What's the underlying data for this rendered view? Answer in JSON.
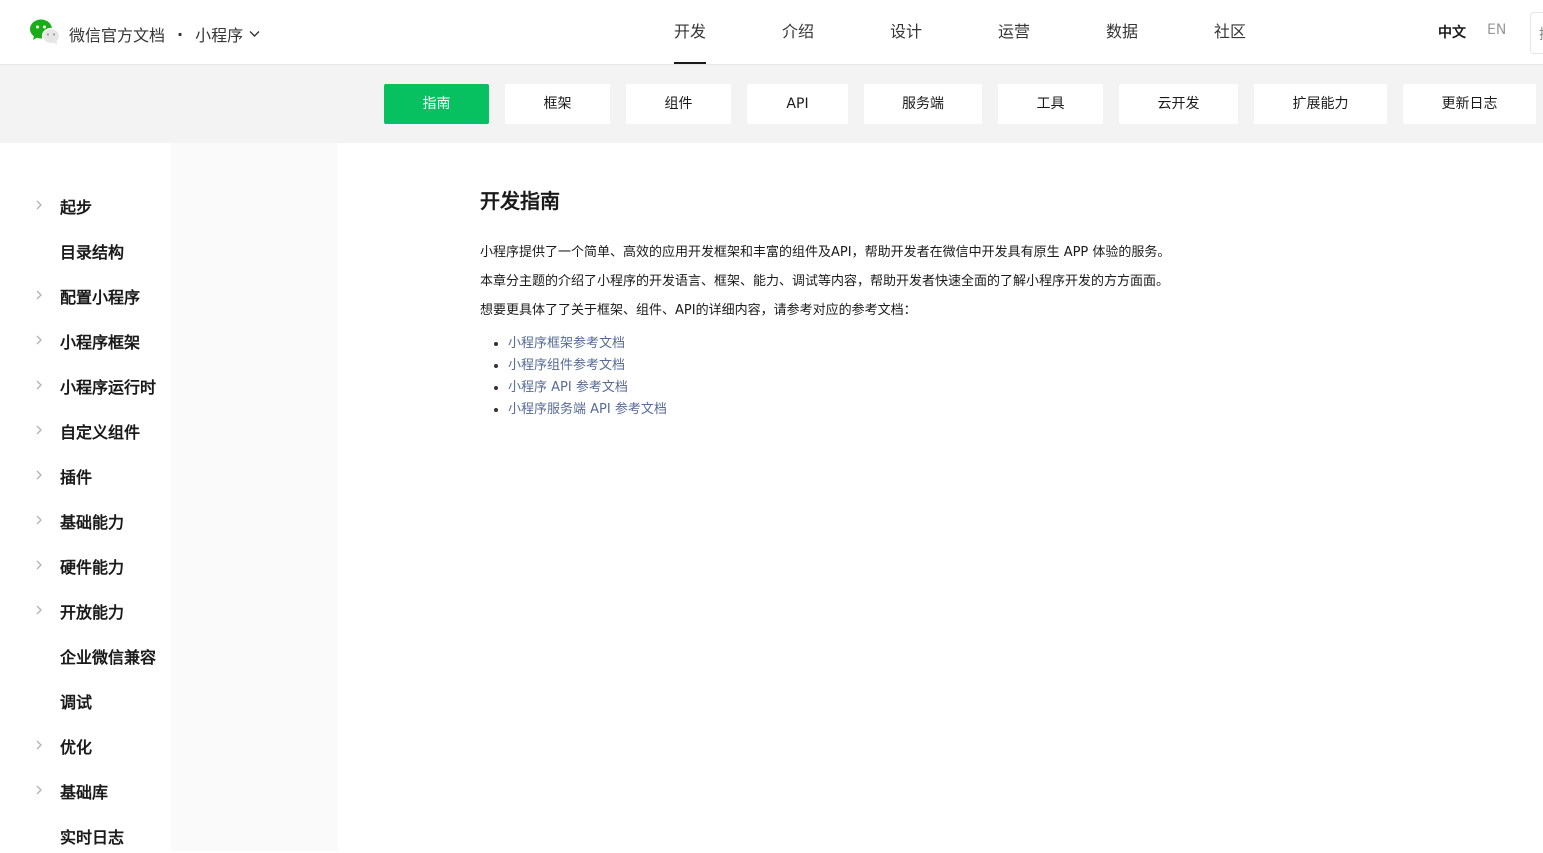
{
  "header": {
    "brand": "微信官方文档",
    "separator": "·",
    "product": "小程序",
    "nav": [
      "开发",
      "介绍",
      "设计",
      "运营",
      "数据",
      "社区"
    ],
    "active_nav": "开发",
    "lang_zh": "中文",
    "lang_en": "EN",
    "search_glyph": "搜"
  },
  "subnav": {
    "tabs": [
      "指南",
      "框架",
      "组件",
      "API",
      "服务端",
      "工具",
      "云开发",
      "扩展能力",
      "更新日志"
    ],
    "active": "指南"
  },
  "sidebar": {
    "items": [
      {
        "label": "起步",
        "expandable": true
      },
      {
        "label": "目录结构",
        "expandable": false
      },
      {
        "label": "配置小程序",
        "expandable": true
      },
      {
        "label": "小程序框架",
        "expandable": true
      },
      {
        "label": "小程序运行时",
        "expandable": true
      },
      {
        "label": "自定义组件",
        "expandable": true
      },
      {
        "label": "插件",
        "expandable": true
      },
      {
        "label": "基础能力",
        "expandable": true
      },
      {
        "label": "硬件能力",
        "expandable": true
      },
      {
        "label": "开放能力",
        "expandable": true
      },
      {
        "label": "企业微信兼容",
        "expandable": false
      },
      {
        "label": "调试",
        "expandable": false
      },
      {
        "label": "优化",
        "expandable": true
      },
      {
        "label": "基础库",
        "expandable": true
      },
      {
        "label": "实时日志",
        "expandable": false
      }
    ]
  },
  "content": {
    "title": "开发指南",
    "paragraphs": [
      "小程序提供了一个简单、高效的应用开发框架和丰富的组件及API，帮助开发者在微信中开发具有原生 APP 体验的服务。",
      "本章分主题的介绍了小程序的开发语言、框架、能力、调试等内容，帮助开发者快速全面的了解小程序开发的方方面面。",
      "想要更具体了了关于框架、组件、API的详细内容，请参考对应的参考文档："
    ],
    "links": [
      "小程序框架参考文档",
      "小程序组件参考文档",
      "小程序 API 参考文档",
      "小程序服务端 API 参考文档"
    ]
  },
  "colors": {
    "accent": "#07c160",
    "link": "#576b95"
  }
}
